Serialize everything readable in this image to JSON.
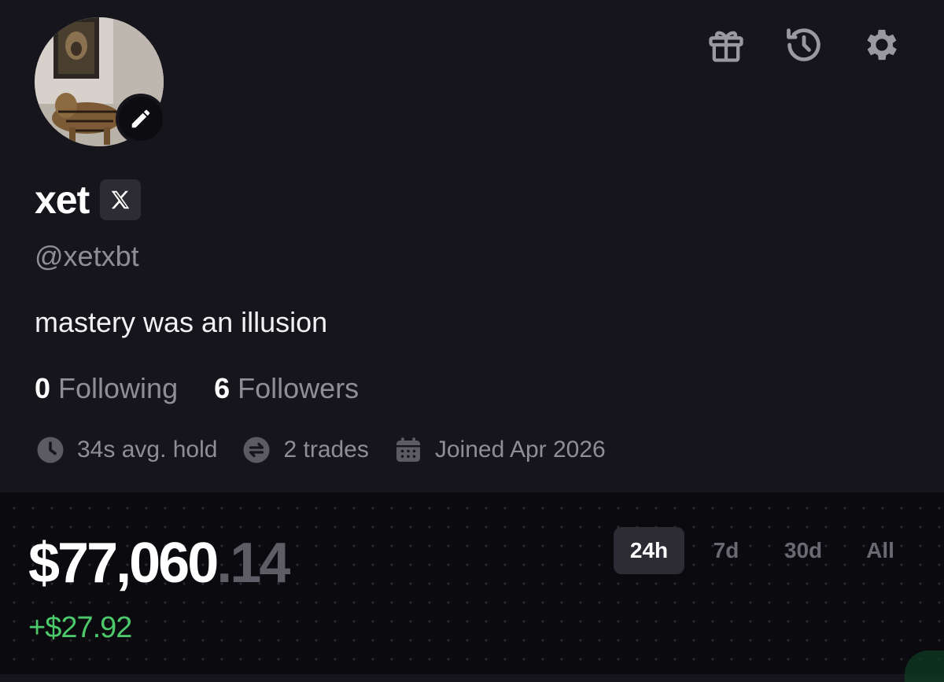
{
  "profile": {
    "display_name": "xet",
    "handle": "@xetxbt",
    "bio": "mastery was an illusion",
    "following_count": "0",
    "following_label": "Following",
    "followers_count": "6",
    "followers_label": "Followers",
    "meta": {
      "avg_hold": "34s avg. hold",
      "trades": "2 trades",
      "joined": "Joined Apr 2026"
    },
    "icons": {
      "avatar_edit": "pencil-icon",
      "x_badge": "x-logo-icon",
      "top": [
        "gift-icon",
        "history-icon",
        "settings-gear-icon"
      ],
      "meta": [
        "clock-icon",
        "swap-icon",
        "calendar-icon"
      ]
    }
  },
  "portfolio": {
    "balance_main": "$77,060",
    "balance_cents": ".14",
    "pnl": "+$27.92",
    "ranges": [
      "24h",
      "7d",
      "30d",
      "All"
    ],
    "active_range": "24h"
  },
  "colors": {
    "background": "#16151c",
    "portfolio_bg": "#0b0a0f",
    "positive": "#4cc96a",
    "muted_text": "#8f8e97"
  }
}
